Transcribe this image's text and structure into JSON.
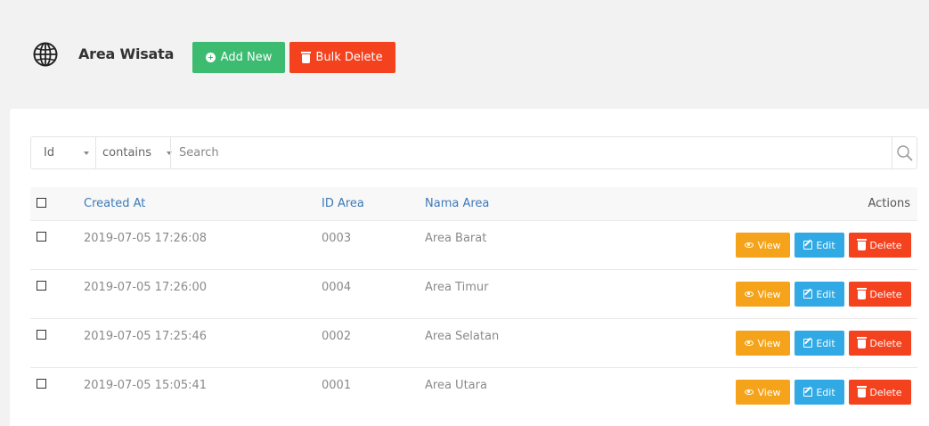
{
  "header": {
    "title": "Area Wisata",
    "add_label": "Add New",
    "bulk_delete_label": "Bulk Delete",
    "icon": "globe-icon"
  },
  "filter": {
    "field": "Id",
    "operator": "contains",
    "placeholder": "Search"
  },
  "table": {
    "columns": {
      "created_at": "Created At",
      "id_area": "ID Area",
      "nama_area": "Nama Area",
      "actions": "Actions"
    },
    "action_labels": {
      "view": "View",
      "edit": "Edit",
      "delete": "Delete"
    },
    "rows": [
      {
        "created_at": "2019-07-05 17:26:08",
        "id_area": "0003",
        "nama_area": "Area Barat"
      },
      {
        "created_at": "2019-07-05 17:26:00",
        "id_area": "0004",
        "nama_area": "Area Timur"
      },
      {
        "created_at": "2019-07-05 17:25:46",
        "id_area": "0002",
        "nama_area": "Area Selatan"
      },
      {
        "created_at": "2019-07-05 15:05:41",
        "id_area": "0001",
        "nama_area": "Area Utara"
      }
    ]
  },
  "colors": {
    "add": "#3dbb71",
    "danger": "#f4411e",
    "view": "#f5a31b",
    "edit": "#31a9e4",
    "link": "#3d7ab9"
  }
}
